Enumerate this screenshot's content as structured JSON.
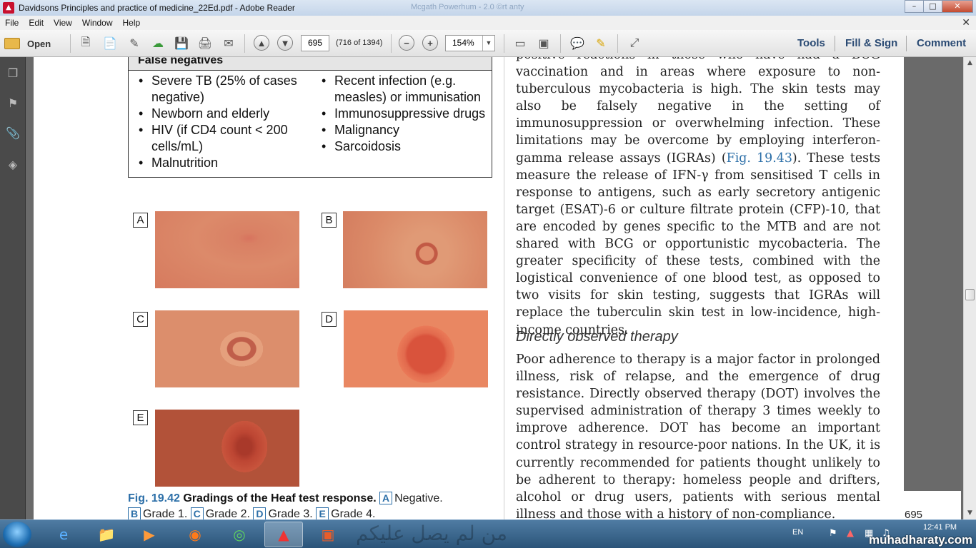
{
  "window": {
    "title": "Davidsons Principles and practice of medicine_22Ed.pdf - Adobe Reader",
    "ghost_title": "Mcgath Powerhum - 2.0 ©rt anty",
    "min": "–",
    "max": "□",
    "close": "✕"
  },
  "menu": {
    "items": [
      "File",
      "Edit",
      "View",
      "Window",
      "Help"
    ],
    "close_doc": "✕"
  },
  "toolbar": {
    "open_label": "Open",
    "page_value": "695",
    "page_count": "(716 of 1394)",
    "zoom_value": "154%",
    "zoom_dropdown": "▼",
    "zoom_out": "−",
    "zoom_in": "+",
    "prev_page": "▲",
    "next_page": "▼",
    "tools": "Tools",
    "fill_sign": "Fill & Sign",
    "comment": "Comment"
  },
  "document": {
    "box_heading": "False negatives",
    "left_col": [
      "Severe TB (25% of cases negative)",
      "Newborn and elderly",
      "HIV (if CD4 count < 200 cells/mL)",
      "Malnutrition"
    ],
    "right_col": [
      "Recent infection (e.g. measles) or immunisation",
      "Immunosuppressive drugs",
      "Malignancy",
      "Sarcoidosis"
    ],
    "plates": {
      "a": "A",
      "b": "B",
      "c": "C",
      "d": "D",
      "e": "E"
    },
    "caption": {
      "fig": "Fig. 19.42",
      "title": "Gradings of the Heaf test response.",
      "neg_label": "A",
      "neg_text": "Negative.",
      "g1_label": "B",
      "g1_text": "Grade 1.",
      "g2_label": "C",
      "g2_text": "Grade 2.",
      "g3_label": "D",
      "g3_text": "Grade 3.",
      "g4_label": "E",
      "g4_text": "Grade 4."
    },
    "para1_a": "positive reactions in those who have had a BCG vaccination and in areas where exposure to non-tuberculous mycobacteria is high. The skin tests may also be falsely negative in the setting of immunosuppression or overwhelming infection. These limitations may be overcome by employing interferon-gamma release assays (IGRAs) (",
    "para1_link": "Fig. 19.43",
    "para1_b": "). These tests measure the release of IFN-γ from sensitised T cells in response to antigens, such as early secretory antigenic target (ESAT)-6 or culture filtrate protein (CFP)-10, that are encoded by genes specific to the MTB and are not shared with BCG or opportunistic mycobacteria. The greater specificity of these tests, combined with the logistical convenience of one blood test, as opposed to two visits for skin testing, suggests that IGRAs will replace the tuberculin skin test in low-incidence, high-income countries.",
    "heading": "Directly observed therapy",
    "para2": "Poor adherence to therapy is a major factor in prolonged illness, risk of relapse, and the emergence of drug resistance. Directly observed therapy (DOT) involves the supervised administration of therapy 3 times weekly to improve adherence. DOT has become an important control strategy in resource-poor nations. In the UK, it is currently recommended for patients thought unlikely to be adherent to therapy: homeless people and drifters, alcohol or drug users, patients with serious mental illness and those with a history of non-compliance.",
    "page_number": "695"
  },
  "scrollbar": {
    "up": "▲",
    "down": "▼"
  },
  "taskbar": {
    "lang": "EN",
    "time": "12:41 PM",
    "arabic_overlay": "من لم يصل عليكم",
    "watermark": "muhadharaty.com"
  }
}
